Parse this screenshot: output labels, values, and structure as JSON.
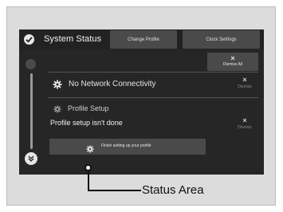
{
  "header": {
    "title": "System Status",
    "tabs": [
      {
        "label": "Change Profile"
      },
      {
        "label": "Clock Settings"
      }
    ]
  },
  "actions": {
    "dismiss_all_icon": "×",
    "dismiss_all_label": "Dismiss All",
    "dismiss_icon": "×",
    "dismiss_label": "Dismiss"
  },
  "notifications": [
    {
      "icon": "gear-icon",
      "title": "No Network Connectivity"
    },
    {
      "icon": "gear-icon",
      "title": "Profile Setup",
      "description": "Profile setup isn't done",
      "action_label": "Finish setting up your profile"
    }
  ],
  "callout": {
    "label": "Status Area"
  }
}
